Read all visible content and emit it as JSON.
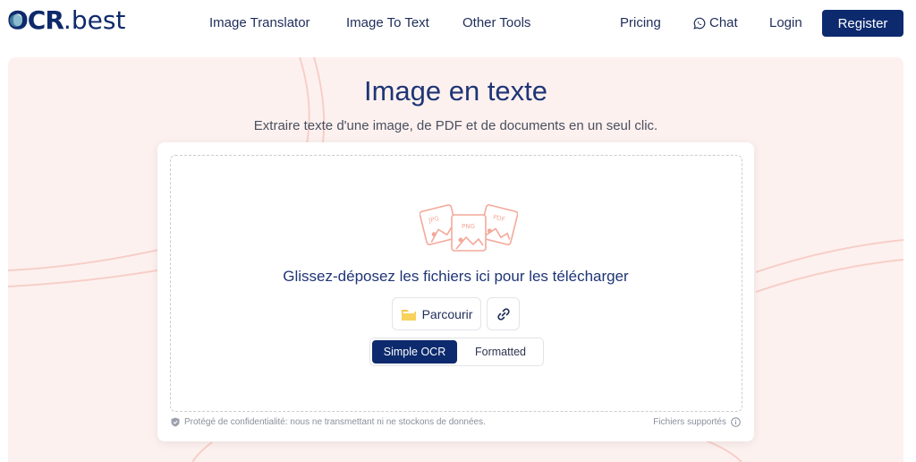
{
  "header": {
    "logo_ocr": "OCR",
    "logo_dot": ".",
    "logo_best": "best",
    "nav": {
      "image_translator": "Image Translator",
      "image_to_text": "Image To Text",
      "other_tools": "Other Tools",
      "pricing": "Pricing",
      "chat": "Chat",
      "login": "Login",
      "register": "Register"
    }
  },
  "hero": {
    "title": "Image en texte",
    "subtitle": "Extraire texte d'une image, de PDF et de documents en un seul clic."
  },
  "upload": {
    "file_labels": {
      "jpg": "JPG",
      "png": "PNG",
      "pdf": "PDF"
    },
    "drop_text": "Glissez-déposez les fichiers ici pour les télécharger",
    "browse_label": "Parcourir",
    "modes": {
      "simple": "Simple OCR",
      "formatted": "Formatted"
    },
    "selected_mode": "Simple OCR",
    "privacy_text": "Protégé de confidentialité: nous ne transmettant ni ne stockons de données.",
    "supported_text": "Fichiers supportés"
  },
  "colors": {
    "brand": "#0d2a6e",
    "hero_bg": "#fdf1ef",
    "accent_illustration": "#f3a99a"
  }
}
